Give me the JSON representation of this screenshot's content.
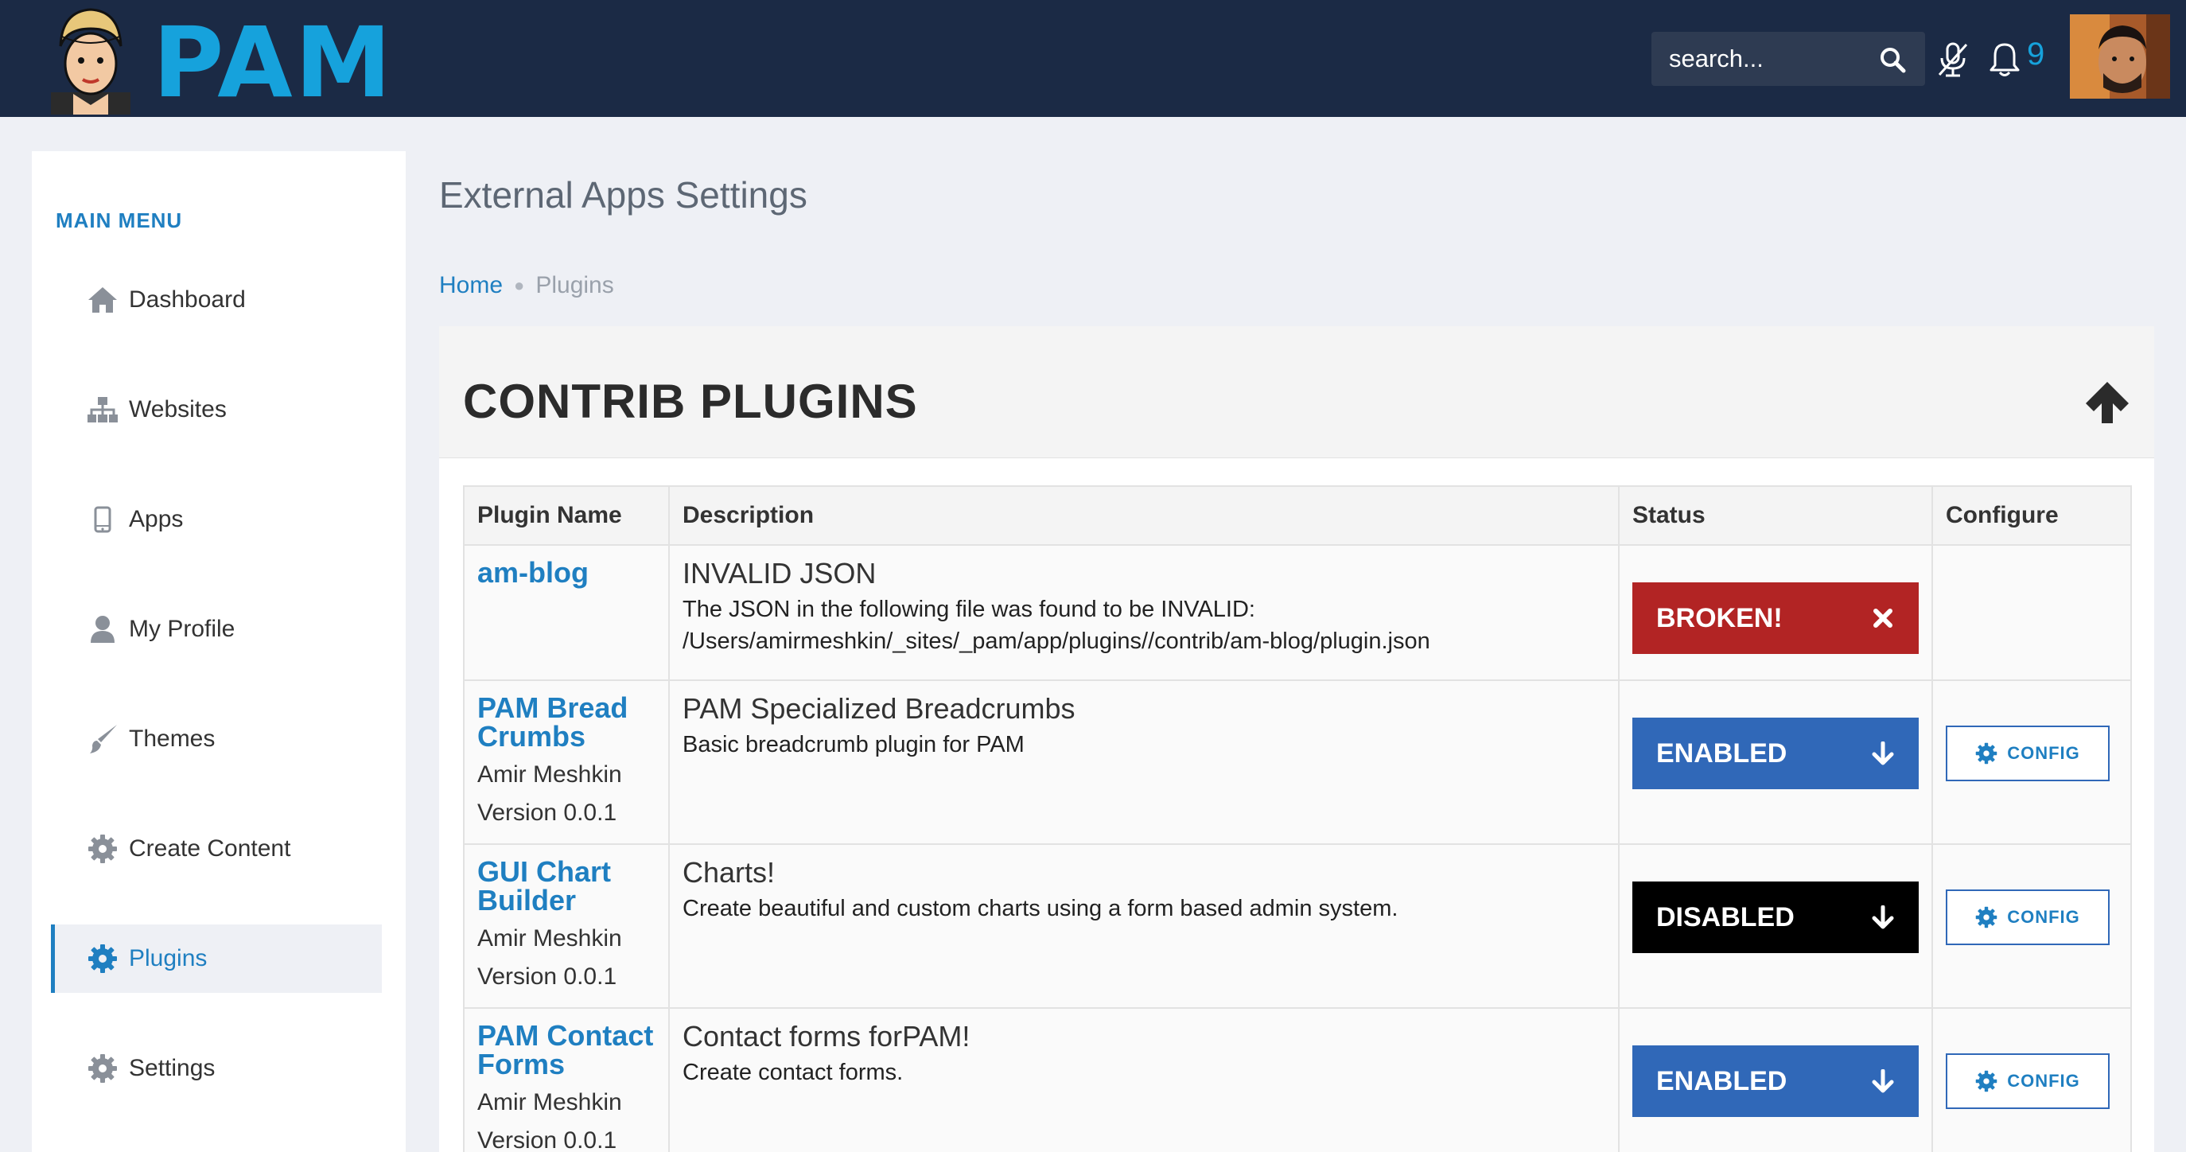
{
  "header": {
    "brand": "PAM",
    "search_placeholder": "search...",
    "notification_count": "9",
    "icons": [
      "search-icon",
      "mic-off-icon",
      "bell-icon"
    ],
    "accent_color": "#16a2dc",
    "bar_color": "#1b2a45"
  },
  "sidebar": {
    "title": "MAIN MENU",
    "active_item": "Plugins",
    "items": [
      {
        "label": "Dashboard",
        "icon": "home-icon"
      },
      {
        "label": "Websites",
        "icon": "sitemap-icon"
      },
      {
        "label": "Apps",
        "icon": "mobile-icon"
      },
      {
        "label": "My Profile",
        "icon": "user-icon"
      },
      {
        "label": "Themes",
        "icon": "brush-icon"
      },
      {
        "label": "Create Content",
        "icon": "gear-icon"
      },
      {
        "label": "Plugins",
        "icon": "gear-icon"
      },
      {
        "label": "Settings",
        "icon": "gear-icon"
      }
    ]
  },
  "page": {
    "title": "External Apps Settings",
    "breadcrumb": {
      "home": "Home",
      "current": "Plugins"
    }
  },
  "panel": {
    "title": "CONTRIB PLUGINS",
    "columns": [
      "Plugin Name",
      "Description",
      "Status",
      "Configure"
    ],
    "rows": [
      {
        "name": "am-blog",
        "author": "",
        "version": "",
        "desc_title": "INVALID JSON",
        "desc_line1": "The JSON in the following file was found to be INVALID:",
        "desc_line2": "/Users/amirmeshkin/_sites/_pam/app/plugins//contrib/am-blog/plugin.json",
        "status": "BROKEN!",
        "status_color": "#b22424",
        "config": ""
      },
      {
        "name": "PAM Bread Crumbs",
        "author": "Amir Meshkin",
        "version": "Version 0.0.1",
        "desc_title": "PAM Specialized Breadcrumbs",
        "desc_line1": "Basic breadcrumb plugin for PAM",
        "desc_line2": "",
        "status": "ENABLED",
        "status_color": "#3068b8",
        "config": "CONFIG"
      },
      {
        "name": "GUI Chart Builder",
        "author": "Amir Meshkin",
        "version": "Version 0.0.1",
        "desc_title": "Charts!",
        "desc_line1": "Create beautiful and custom charts using a form based admin system.",
        "desc_line2": "",
        "status": "DISABLED",
        "status_color": "#000000",
        "config": "CONFIG"
      },
      {
        "name": "PAM Contact Forms",
        "author": "Amir Meshkin",
        "version": "Version 0.0.1",
        "desc_title": "Contact forms forPAM!",
        "desc_line1": "Create contact forms.",
        "desc_line2": "",
        "status": "ENABLED",
        "status_color": "#3068b8",
        "config": "CONFIG"
      }
    ]
  }
}
